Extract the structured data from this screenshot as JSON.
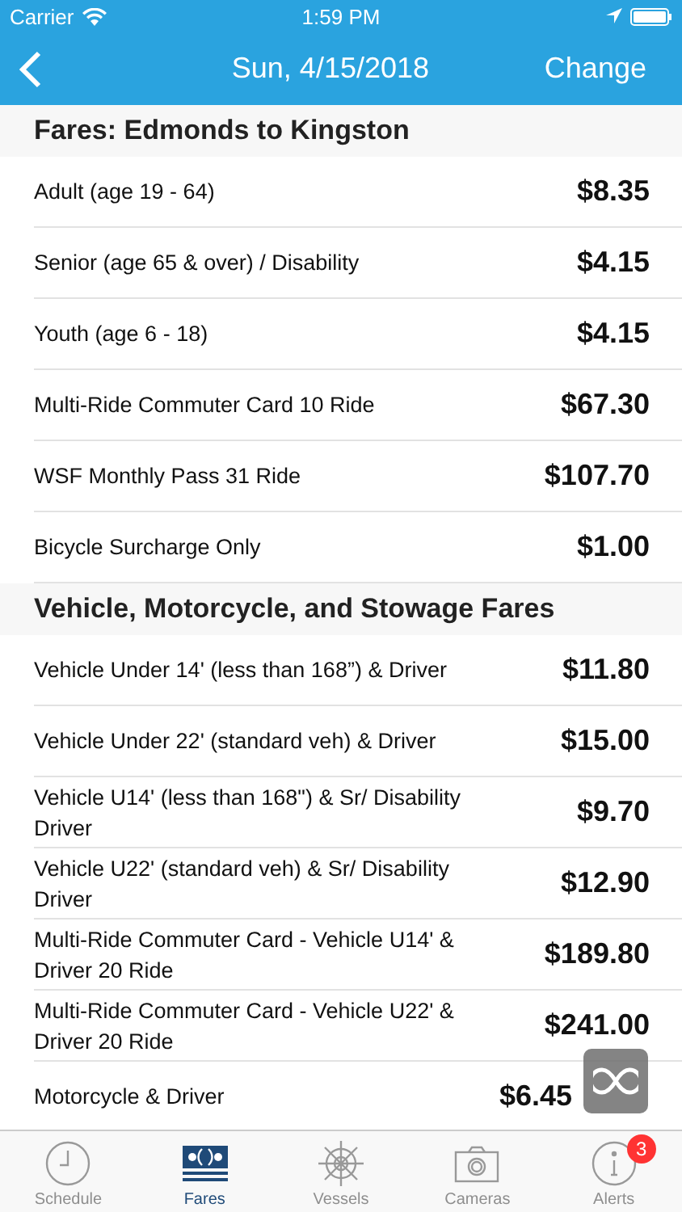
{
  "status_bar": {
    "carrier": "Carrier",
    "time": "1:59 PM"
  },
  "nav": {
    "title": "Sun, 4/15/2018",
    "action": "Change"
  },
  "sections": [
    {
      "title": "Fares: Edmonds to Kingston",
      "rows": [
        {
          "label": "Adult (age 19 - 64)",
          "price": "$8.35"
        },
        {
          "label": "Senior (age 65 & over) / Disability",
          "price": "$4.15"
        },
        {
          "label": "Youth (age 6 - 18)",
          "price": "$4.15"
        },
        {
          "label": "Multi-Ride Commuter Card 10 Ride",
          "price": "$67.30"
        },
        {
          "label": "WSF Monthly Pass 31 Ride",
          "price": "$107.70"
        },
        {
          "label": "Bicycle Surcharge Only",
          "price": "$1.00"
        }
      ]
    },
    {
      "title": "Vehicle, Motorcycle, and Stowage Fares",
      "rows": [
        {
          "label": "Vehicle Under 14' (less than 168”) & Driver",
          "price": "$11.80"
        },
        {
          "label": "Vehicle Under 22' (standard veh) & Driver",
          "price": "$15.00"
        },
        {
          "label": "Vehicle U14' (less than 168\") & Sr/ Disability Driver",
          "price": "$9.70"
        },
        {
          "label": "Vehicle U22' (standard veh) & Sr/ Disability Driver",
          "price": "$12.90"
        },
        {
          "label": "Multi-Ride Commuter Card - Vehicle U14' & Driver 20 Ride",
          "price": "$189.80"
        },
        {
          "label": "Multi-Ride Commuter Card - Vehicle U22' & Driver 20 Ride",
          "price": "$241.00"
        },
        {
          "label": "Motorcycle & Driver",
          "price": "$6.45"
        }
      ]
    }
  ],
  "tabs": [
    {
      "label": "Schedule",
      "kind": "clock",
      "selected": false
    },
    {
      "label": "Fares",
      "kind": "ticket",
      "selected": true
    },
    {
      "label": "Vessels",
      "kind": "wheel",
      "selected": false
    },
    {
      "label": "Cameras",
      "kind": "camera",
      "selected": false
    },
    {
      "label": "Alerts",
      "kind": "info",
      "selected": false,
      "badge": "3"
    }
  ]
}
